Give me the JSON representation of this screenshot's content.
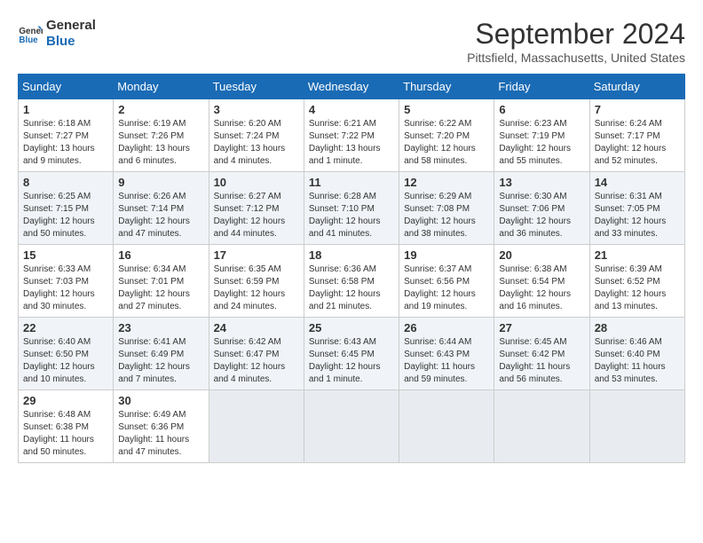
{
  "logo": {
    "line1": "General",
    "line2": "Blue"
  },
  "title": "September 2024",
  "location": "Pittsfield, Massachusetts, United States",
  "weekdays": [
    "Sunday",
    "Monday",
    "Tuesday",
    "Wednesday",
    "Thursday",
    "Friday",
    "Saturday"
  ],
  "weeks": [
    [
      {
        "day": "1",
        "info": "Sunrise: 6:18 AM\nSunset: 7:27 PM\nDaylight: 13 hours\nand 9 minutes."
      },
      {
        "day": "2",
        "info": "Sunrise: 6:19 AM\nSunset: 7:26 PM\nDaylight: 13 hours\nand 6 minutes."
      },
      {
        "day": "3",
        "info": "Sunrise: 6:20 AM\nSunset: 7:24 PM\nDaylight: 13 hours\nand 4 minutes."
      },
      {
        "day": "4",
        "info": "Sunrise: 6:21 AM\nSunset: 7:22 PM\nDaylight: 13 hours\nand 1 minute."
      },
      {
        "day": "5",
        "info": "Sunrise: 6:22 AM\nSunset: 7:20 PM\nDaylight: 12 hours\nand 58 minutes."
      },
      {
        "day": "6",
        "info": "Sunrise: 6:23 AM\nSunset: 7:19 PM\nDaylight: 12 hours\nand 55 minutes."
      },
      {
        "day": "7",
        "info": "Sunrise: 6:24 AM\nSunset: 7:17 PM\nDaylight: 12 hours\nand 52 minutes."
      }
    ],
    [
      {
        "day": "8",
        "info": "Sunrise: 6:25 AM\nSunset: 7:15 PM\nDaylight: 12 hours\nand 50 minutes."
      },
      {
        "day": "9",
        "info": "Sunrise: 6:26 AM\nSunset: 7:14 PM\nDaylight: 12 hours\nand 47 minutes."
      },
      {
        "day": "10",
        "info": "Sunrise: 6:27 AM\nSunset: 7:12 PM\nDaylight: 12 hours\nand 44 minutes."
      },
      {
        "day": "11",
        "info": "Sunrise: 6:28 AM\nSunset: 7:10 PM\nDaylight: 12 hours\nand 41 minutes."
      },
      {
        "day": "12",
        "info": "Sunrise: 6:29 AM\nSunset: 7:08 PM\nDaylight: 12 hours\nand 38 minutes."
      },
      {
        "day": "13",
        "info": "Sunrise: 6:30 AM\nSunset: 7:06 PM\nDaylight: 12 hours\nand 36 minutes."
      },
      {
        "day": "14",
        "info": "Sunrise: 6:31 AM\nSunset: 7:05 PM\nDaylight: 12 hours\nand 33 minutes."
      }
    ],
    [
      {
        "day": "15",
        "info": "Sunrise: 6:33 AM\nSunset: 7:03 PM\nDaylight: 12 hours\nand 30 minutes."
      },
      {
        "day": "16",
        "info": "Sunrise: 6:34 AM\nSunset: 7:01 PM\nDaylight: 12 hours\nand 27 minutes."
      },
      {
        "day": "17",
        "info": "Sunrise: 6:35 AM\nSunset: 6:59 PM\nDaylight: 12 hours\nand 24 minutes."
      },
      {
        "day": "18",
        "info": "Sunrise: 6:36 AM\nSunset: 6:58 PM\nDaylight: 12 hours\nand 21 minutes."
      },
      {
        "day": "19",
        "info": "Sunrise: 6:37 AM\nSunset: 6:56 PM\nDaylight: 12 hours\nand 19 minutes."
      },
      {
        "day": "20",
        "info": "Sunrise: 6:38 AM\nSunset: 6:54 PM\nDaylight: 12 hours\nand 16 minutes."
      },
      {
        "day": "21",
        "info": "Sunrise: 6:39 AM\nSunset: 6:52 PM\nDaylight: 12 hours\nand 13 minutes."
      }
    ],
    [
      {
        "day": "22",
        "info": "Sunrise: 6:40 AM\nSunset: 6:50 PM\nDaylight: 12 hours\nand 10 minutes."
      },
      {
        "day": "23",
        "info": "Sunrise: 6:41 AM\nSunset: 6:49 PM\nDaylight: 12 hours\nand 7 minutes."
      },
      {
        "day": "24",
        "info": "Sunrise: 6:42 AM\nSunset: 6:47 PM\nDaylight: 12 hours\nand 4 minutes."
      },
      {
        "day": "25",
        "info": "Sunrise: 6:43 AM\nSunset: 6:45 PM\nDaylight: 12 hours\nand 1 minute."
      },
      {
        "day": "26",
        "info": "Sunrise: 6:44 AM\nSunset: 6:43 PM\nDaylight: 11 hours\nand 59 minutes."
      },
      {
        "day": "27",
        "info": "Sunrise: 6:45 AM\nSunset: 6:42 PM\nDaylight: 11 hours\nand 56 minutes."
      },
      {
        "day": "28",
        "info": "Sunrise: 6:46 AM\nSunset: 6:40 PM\nDaylight: 11 hours\nand 53 minutes."
      }
    ],
    [
      {
        "day": "29",
        "info": "Sunrise: 6:48 AM\nSunset: 6:38 PM\nDaylight: 11 hours\nand 50 minutes."
      },
      {
        "day": "30",
        "info": "Sunrise: 6:49 AM\nSunset: 6:36 PM\nDaylight: 11 hours\nand 47 minutes."
      },
      {
        "day": "",
        "info": ""
      },
      {
        "day": "",
        "info": ""
      },
      {
        "day": "",
        "info": ""
      },
      {
        "day": "",
        "info": ""
      },
      {
        "day": "",
        "info": ""
      }
    ]
  ]
}
